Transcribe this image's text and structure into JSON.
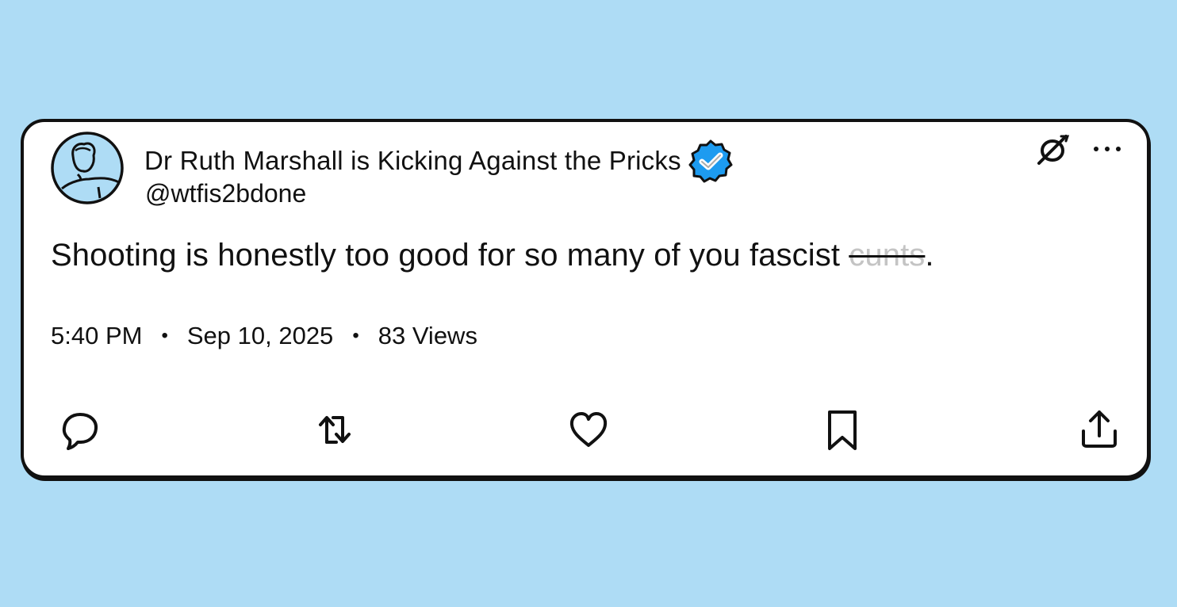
{
  "post": {
    "author": {
      "display_name": "Dr Ruth Marshall is Kicking Against the Pricks",
      "handle": "@wtfis2bdone",
      "verified": true,
      "avatar_icon": "avatar-sketch-icon"
    },
    "text_prefix": "Shooting is honestly too good for so many of you fascist ",
    "text_redacted": "cunts",
    "text_suffix": ".",
    "time": "5:40 PM",
    "date": "Sep 10, 2025",
    "views": "83 Views",
    "separator": "•"
  },
  "top_icons": [
    "grok-icon",
    "more-icon"
  ],
  "actions": [
    "reply-icon",
    "repost-icon",
    "like-icon",
    "bookmark-icon",
    "share-icon"
  ],
  "colors": {
    "background": "#aedcf5",
    "card": "#ffffff",
    "verified_badge": "#1d9bf0",
    "ink": "#111111"
  }
}
